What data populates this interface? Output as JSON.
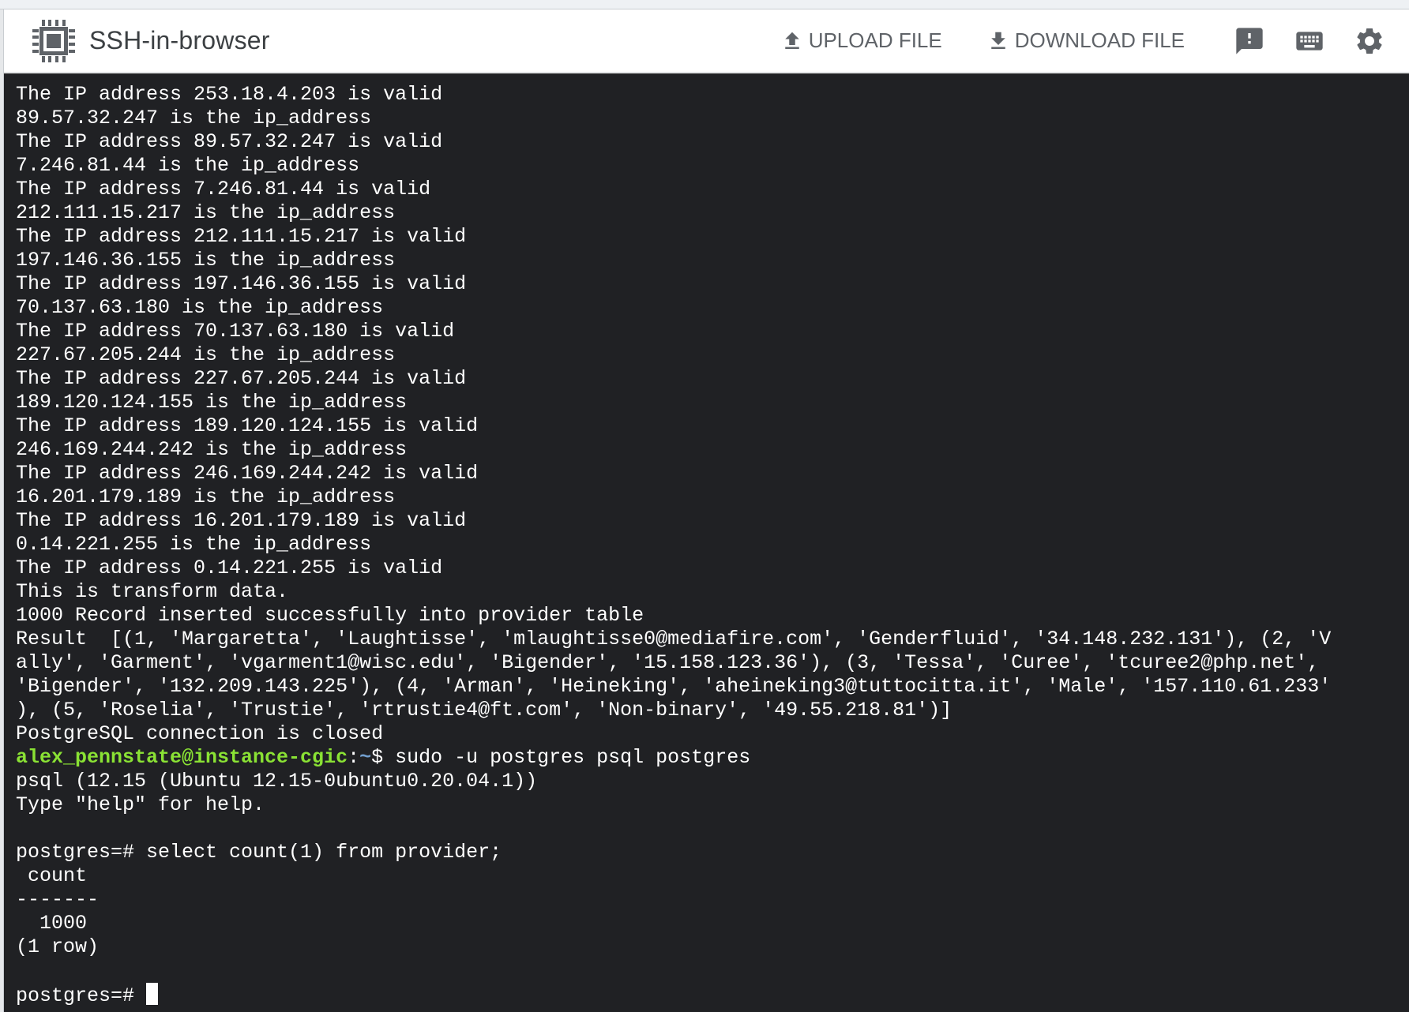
{
  "header": {
    "title": "SSH-in-browser",
    "upload_label": "UPLOAD FILE",
    "download_label": "DOWNLOAD FILE",
    "icons": [
      "chip-icon",
      "upload-icon",
      "download-icon",
      "feedback-icon",
      "keyboard-icon",
      "gear-icon"
    ]
  },
  "colors": {
    "terminal_bg": "#202124",
    "terminal_fg": "#ffffff",
    "prompt_user": "#8ae234",
    "prompt_path": "#729fcf",
    "header_text": "#5f6368"
  },
  "terminal": {
    "lines": [
      "The IP address 253.18.4.203 is valid",
      "89.57.32.247 is the ip_address",
      "The IP address 89.57.32.247 is valid",
      "7.246.81.44 is the ip_address",
      "The IP address 7.246.81.44 is valid",
      "212.111.15.217 is the ip_address",
      "The IP address 212.111.15.217 is valid",
      "197.146.36.155 is the ip_address",
      "The IP address 197.146.36.155 is valid",
      "70.137.63.180 is the ip_address",
      "The IP address 70.137.63.180 is valid",
      "227.67.205.244 is the ip_address",
      "The IP address 227.67.205.244 is valid",
      "189.120.124.155 is the ip_address",
      "The IP address 189.120.124.155 is valid",
      "246.169.244.242 is the ip_address",
      "The IP address 246.169.244.242 is valid",
      "16.201.179.189 is the ip_address",
      "The IP address 16.201.179.189 is valid",
      "0.14.221.255 is the ip_address",
      "The IP address 0.14.221.255 is valid",
      "This is transform data.",
      "1000 Record inserted successfully into provider table",
      "Result  [(1, 'Margaretta', 'Laughtisse', 'mlaughtisse0@mediafire.com', 'Genderfluid', '34.148.232.131'), (2, 'V",
      "ally', 'Garment', 'vgarment1@wisc.edu', 'Bigender', '15.158.123.36'), (3, 'Tessa', 'Curee', 'tcuree2@php.net',",
      "'Bigender', '132.209.143.225'), (4, 'Arman', 'Heineking', 'aheineking3@tuttocitta.it', 'Male', '157.110.61.233'",
      "), (5, 'Roselia', 'Trustie', 'rtrustie4@ft.com', 'Non-binary', '49.55.218.81')]",
      "PostgreSQL connection is closed"
    ],
    "prompt": {
      "user_host": "alex_pennstate@instance-cgic",
      "separator": ":",
      "path": "~",
      "symbol": "$ ",
      "command": "sudo -u postgres psql postgres"
    },
    "psql_lines": [
      "psql (12.15 (Ubuntu 12.15-0ubuntu0.20.04.1))",
      "Type \"help\" for help.",
      "",
      "postgres=# select count(1) from provider;",
      " count",
      "-------",
      "  1000",
      "(1 row)",
      ""
    ],
    "final_prompt": "postgres=# "
  }
}
